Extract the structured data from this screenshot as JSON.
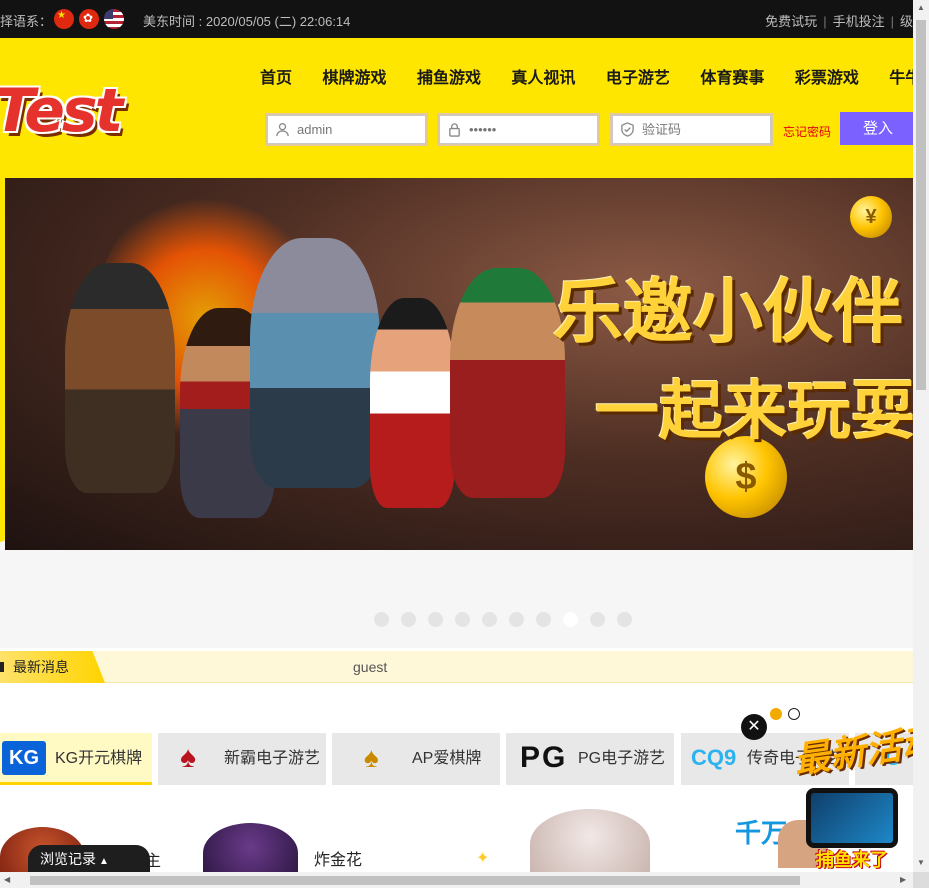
{
  "topbar": {
    "lang_label": "择语系：",
    "flags": [
      "cn-flag-icon",
      "hk-flag-icon",
      "us-flag-icon"
    ],
    "time_label": "美东时间 : 2020/05/05 (二) 22:06:14",
    "links": [
      "免费试玩",
      "手机投注",
      "级"
    ]
  },
  "logo": {
    "text": "Test"
  },
  "nav": [
    "首页",
    "棋牌游戏",
    "捕鱼游戏",
    "真人视讯",
    "电子游艺",
    "体育赛事",
    "彩票游戏",
    "牛牛游戏"
  ],
  "login": {
    "username_value": "admin",
    "password_value": "••••••",
    "captcha_placeholder": "验证码",
    "forgot_label": "忘记密码",
    "submit_label": "登入"
  },
  "banner": {
    "title_line1": "乐邀小伙伴",
    "title_line2": "一起来玩耍",
    "slide_count": 10,
    "active_slide": 8,
    "coin_small": "¥",
    "coin_big": "$"
  },
  "news": {
    "label": "最新消息",
    "text": "guest"
  },
  "providers": [
    {
      "logo": "KG",
      "label": "KG开元棋牌",
      "active": true
    },
    {
      "logo": "♠",
      "label": "新霸电子游艺",
      "active": false
    },
    {
      "logo": "♠",
      "label": "AP爱棋牌",
      "active": false
    },
    {
      "logo": "PG",
      "label": "PG电子游艺",
      "active": false
    },
    {
      "logo": "CQ9",
      "label": "传奇电子游艺",
      "active": false
    },
    {
      "logo": "C",
      "label": "",
      "active": false
    }
  ],
  "games": {
    "game1": "斗地主",
    "game2": "炸金花",
    "promo_title": "千万"
  },
  "history": {
    "label": "浏览记录",
    "arrow": "▲"
  },
  "floating_promo": {
    "close": "✕",
    "title": "最新活动",
    "subtitle": "捕鱼来了"
  },
  "colors": {
    "header_yellow": "#ffe600",
    "login_button": "#7b61ff",
    "forgot_red": "#e60012",
    "topbar_bg": "#121212"
  }
}
